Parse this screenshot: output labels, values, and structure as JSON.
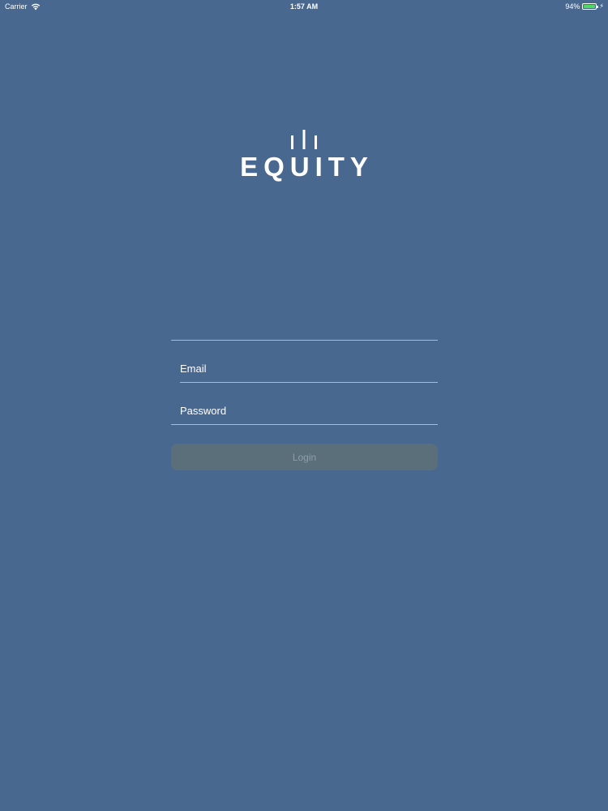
{
  "theme": {
    "background": "#496890",
    "battery_color": "#4cd964",
    "button_bg": "#5b6f7b",
    "button_text": "#8d9ea9"
  },
  "status_bar": {
    "carrier": "Carrier",
    "time": "1:57 AM",
    "battery_percent_label": "94%",
    "battery_level": 0.94,
    "icons": [
      "wifi-icon",
      "battery-icon",
      "charging-icon"
    ]
  },
  "logo": {
    "text": "EQUITY",
    "mark_icon": "three-bars-logo-mark"
  },
  "form": {
    "email_placeholder": "Email",
    "email_value": "",
    "password_placeholder": "Password",
    "password_value": "",
    "login_label": "Login"
  }
}
